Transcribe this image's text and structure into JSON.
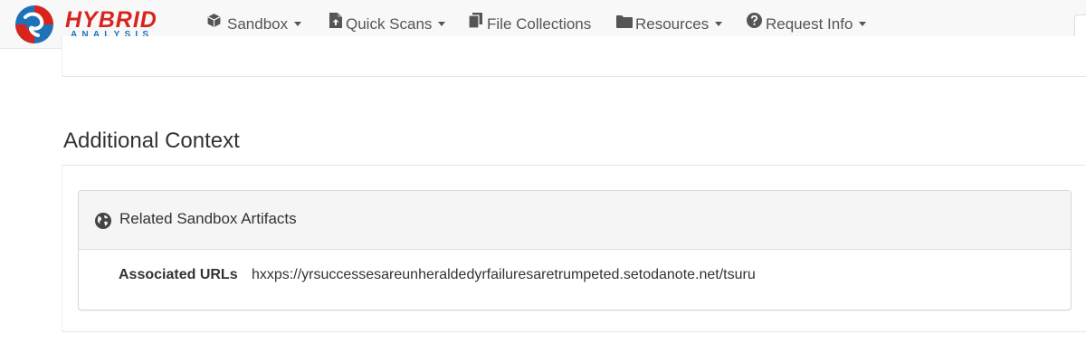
{
  "brand": {
    "word1": "HYBRID",
    "word2": "ANALYSIS",
    "colors": {
      "red": "#d9231d",
      "blue": "#1e73b8"
    }
  },
  "nav": [
    {
      "label": "Sandbox",
      "icon": "cube-icon",
      "dropdown": true
    },
    {
      "label": "Quick Scans",
      "icon": "file-upload-icon",
      "dropdown": true
    },
    {
      "label": "File Collections",
      "icon": "files-icon",
      "dropdown": false
    },
    {
      "label": "Resources",
      "icon": "folder-icon",
      "dropdown": true
    },
    {
      "label": "Request Info",
      "icon": "question-circle-icon",
      "dropdown": true
    }
  ],
  "section": {
    "title": "Additional Context"
  },
  "panel": {
    "title": "Related Sandbox Artifacts",
    "icon": "globe-icon",
    "rows": [
      {
        "label": "Associated URLs",
        "value": "hxxps://yrsuccessesareunheraldedyrfailuresaretrumpeted.setodanote.net/tsuru"
      }
    ]
  }
}
